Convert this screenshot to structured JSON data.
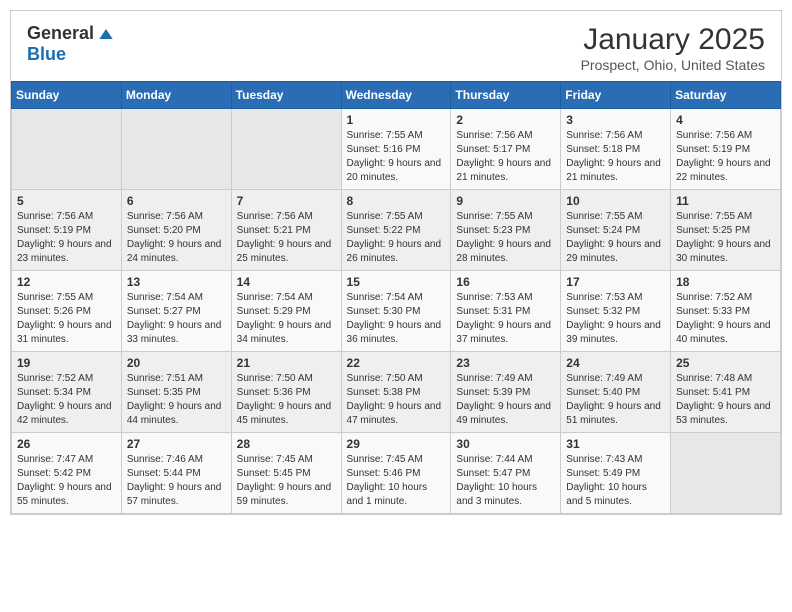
{
  "logo": {
    "general": "General",
    "blue": "Blue"
  },
  "title": "January 2025",
  "subtitle": "Prospect, Ohio, United States",
  "days_of_week": [
    "Sunday",
    "Monday",
    "Tuesday",
    "Wednesday",
    "Thursday",
    "Friday",
    "Saturday"
  ],
  "weeks": [
    [
      {
        "day": "",
        "sunrise": "",
        "sunset": "",
        "daylight": "",
        "empty": true
      },
      {
        "day": "",
        "sunrise": "",
        "sunset": "",
        "daylight": "",
        "empty": true
      },
      {
        "day": "",
        "sunrise": "",
        "sunset": "",
        "daylight": "",
        "empty": true
      },
      {
        "day": "1",
        "sunrise": "Sunrise: 7:55 AM",
        "sunset": "Sunset: 5:16 PM",
        "daylight": "Daylight: 9 hours and 20 minutes."
      },
      {
        "day": "2",
        "sunrise": "Sunrise: 7:56 AM",
        "sunset": "Sunset: 5:17 PM",
        "daylight": "Daylight: 9 hours and 21 minutes."
      },
      {
        "day": "3",
        "sunrise": "Sunrise: 7:56 AM",
        "sunset": "Sunset: 5:18 PM",
        "daylight": "Daylight: 9 hours and 21 minutes."
      },
      {
        "day": "4",
        "sunrise": "Sunrise: 7:56 AM",
        "sunset": "Sunset: 5:19 PM",
        "daylight": "Daylight: 9 hours and 22 minutes."
      }
    ],
    [
      {
        "day": "5",
        "sunrise": "Sunrise: 7:56 AM",
        "sunset": "Sunset: 5:19 PM",
        "daylight": "Daylight: 9 hours and 23 minutes."
      },
      {
        "day": "6",
        "sunrise": "Sunrise: 7:56 AM",
        "sunset": "Sunset: 5:20 PM",
        "daylight": "Daylight: 9 hours and 24 minutes."
      },
      {
        "day": "7",
        "sunrise": "Sunrise: 7:56 AM",
        "sunset": "Sunset: 5:21 PM",
        "daylight": "Daylight: 9 hours and 25 minutes."
      },
      {
        "day": "8",
        "sunrise": "Sunrise: 7:55 AM",
        "sunset": "Sunset: 5:22 PM",
        "daylight": "Daylight: 9 hours and 26 minutes."
      },
      {
        "day": "9",
        "sunrise": "Sunrise: 7:55 AM",
        "sunset": "Sunset: 5:23 PM",
        "daylight": "Daylight: 9 hours and 28 minutes."
      },
      {
        "day": "10",
        "sunrise": "Sunrise: 7:55 AM",
        "sunset": "Sunset: 5:24 PM",
        "daylight": "Daylight: 9 hours and 29 minutes."
      },
      {
        "day": "11",
        "sunrise": "Sunrise: 7:55 AM",
        "sunset": "Sunset: 5:25 PM",
        "daylight": "Daylight: 9 hours and 30 minutes."
      }
    ],
    [
      {
        "day": "12",
        "sunrise": "Sunrise: 7:55 AM",
        "sunset": "Sunset: 5:26 PM",
        "daylight": "Daylight: 9 hours and 31 minutes."
      },
      {
        "day": "13",
        "sunrise": "Sunrise: 7:54 AM",
        "sunset": "Sunset: 5:27 PM",
        "daylight": "Daylight: 9 hours and 33 minutes."
      },
      {
        "day": "14",
        "sunrise": "Sunrise: 7:54 AM",
        "sunset": "Sunset: 5:29 PM",
        "daylight": "Daylight: 9 hours and 34 minutes."
      },
      {
        "day": "15",
        "sunrise": "Sunrise: 7:54 AM",
        "sunset": "Sunset: 5:30 PM",
        "daylight": "Daylight: 9 hours and 36 minutes."
      },
      {
        "day": "16",
        "sunrise": "Sunrise: 7:53 AM",
        "sunset": "Sunset: 5:31 PM",
        "daylight": "Daylight: 9 hours and 37 minutes."
      },
      {
        "day": "17",
        "sunrise": "Sunrise: 7:53 AM",
        "sunset": "Sunset: 5:32 PM",
        "daylight": "Daylight: 9 hours and 39 minutes."
      },
      {
        "day": "18",
        "sunrise": "Sunrise: 7:52 AM",
        "sunset": "Sunset: 5:33 PM",
        "daylight": "Daylight: 9 hours and 40 minutes."
      }
    ],
    [
      {
        "day": "19",
        "sunrise": "Sunrise: 7:52 AM",
        "sunset": "Sunset: 5:34 PM",
        "daylight": "Daylight: 9 hours and 42 minutes."
      },
      {
        "day": "20",
        "sunrise": "Sunrise: 7:51 AM",
        "sunset": "Sunset: 5:35 PM",
        "daylight": "Daylight: 9 hours and 44 minutes."
      },
      {
        "day": "21",
        "sunrise": "Sunrise: 7:50 AM",
        "sunset": "Sunset: 5:36 PM",
        "daylight": "Daylight: 9 hours and 45 minutes."
      },
      {
        "day": "22",
        "sunrise": "Sunrise: 7:50 AM",
        "sunset": "Sunset: 5:38 PM",
        "daylight": "Daylight: 9 hours and 47 minutes."
      },
      {
        "day": "23",
        "sunrise": "Sunrise: 7:49 AM",
        "sunset": "Sunset: 5:39 PM",
        "daylight": "Daylight: 9 hours and 49 minutes."
      },
      {
        "day": "24",
        "sunrise": "Sunrise: 7:49 AM",
        "sunset": "Sunset: 5:40 PM",
        "daylight": "Daylight: 9 hours and 51 minutes."
      },
      {
        "day": "25",
        "sunrise": "Sunrise: 7:48 AM",
        "sunset": "Sunset: 5:41 PM",
        "daylight": "Daylight: 9 hours and 53 minutes."
      }
    ],
    [
      {
        "day": "26",
        "sunrise": "Sunrise: 7:47 AM",
        "sunset": "Sunset: 5:42 PM",
        "daylight": "Daylight: 9 hours and 55 minutes."
      },
      {
        "day": "27",
        "sunrise": "Sunrise: 7:46 AM",
        "sunset": "Sunset: 5:44 PM",
        "daylight": "Daylight: 9 hours and 57 minutes."
      },
      {
        "day": "28",
        "sunrise": "Sunrise: 7:45 AM",
        "sunset": "Sunset: 5:45 PM",
        "daylight": "Daylight: 9 hours and 59 minutes."
      },
      {
        "day": "29",
        "sunrise": "Sunrise: 7:45 AM",
        "sunset": "Sunset: 5:46 PM",
        "daylight": "Daylight: 10 hours and 1 minute."
      },
      {
        "day": "30",
        "sunrise": "Sunrise: 7:44 AM",
        "sunset": "Sunset: 5:47 PM",
        "daylight": "Daylight: 10 hours and 3 minutes."
      },
      {
        "day": "31",
        "sunrise": "Sunrise: 7:43 AM",
        "sunset": "Sunset: 5:49 PM",
        "daylight": "Daylight: 10 hours and 5 minutes."
      },
      {
        "day": "",
        "sunrise": "",
        "sunset": "",
        "daylight": "",
        "empty": true
      }
    ]
  ]
}
